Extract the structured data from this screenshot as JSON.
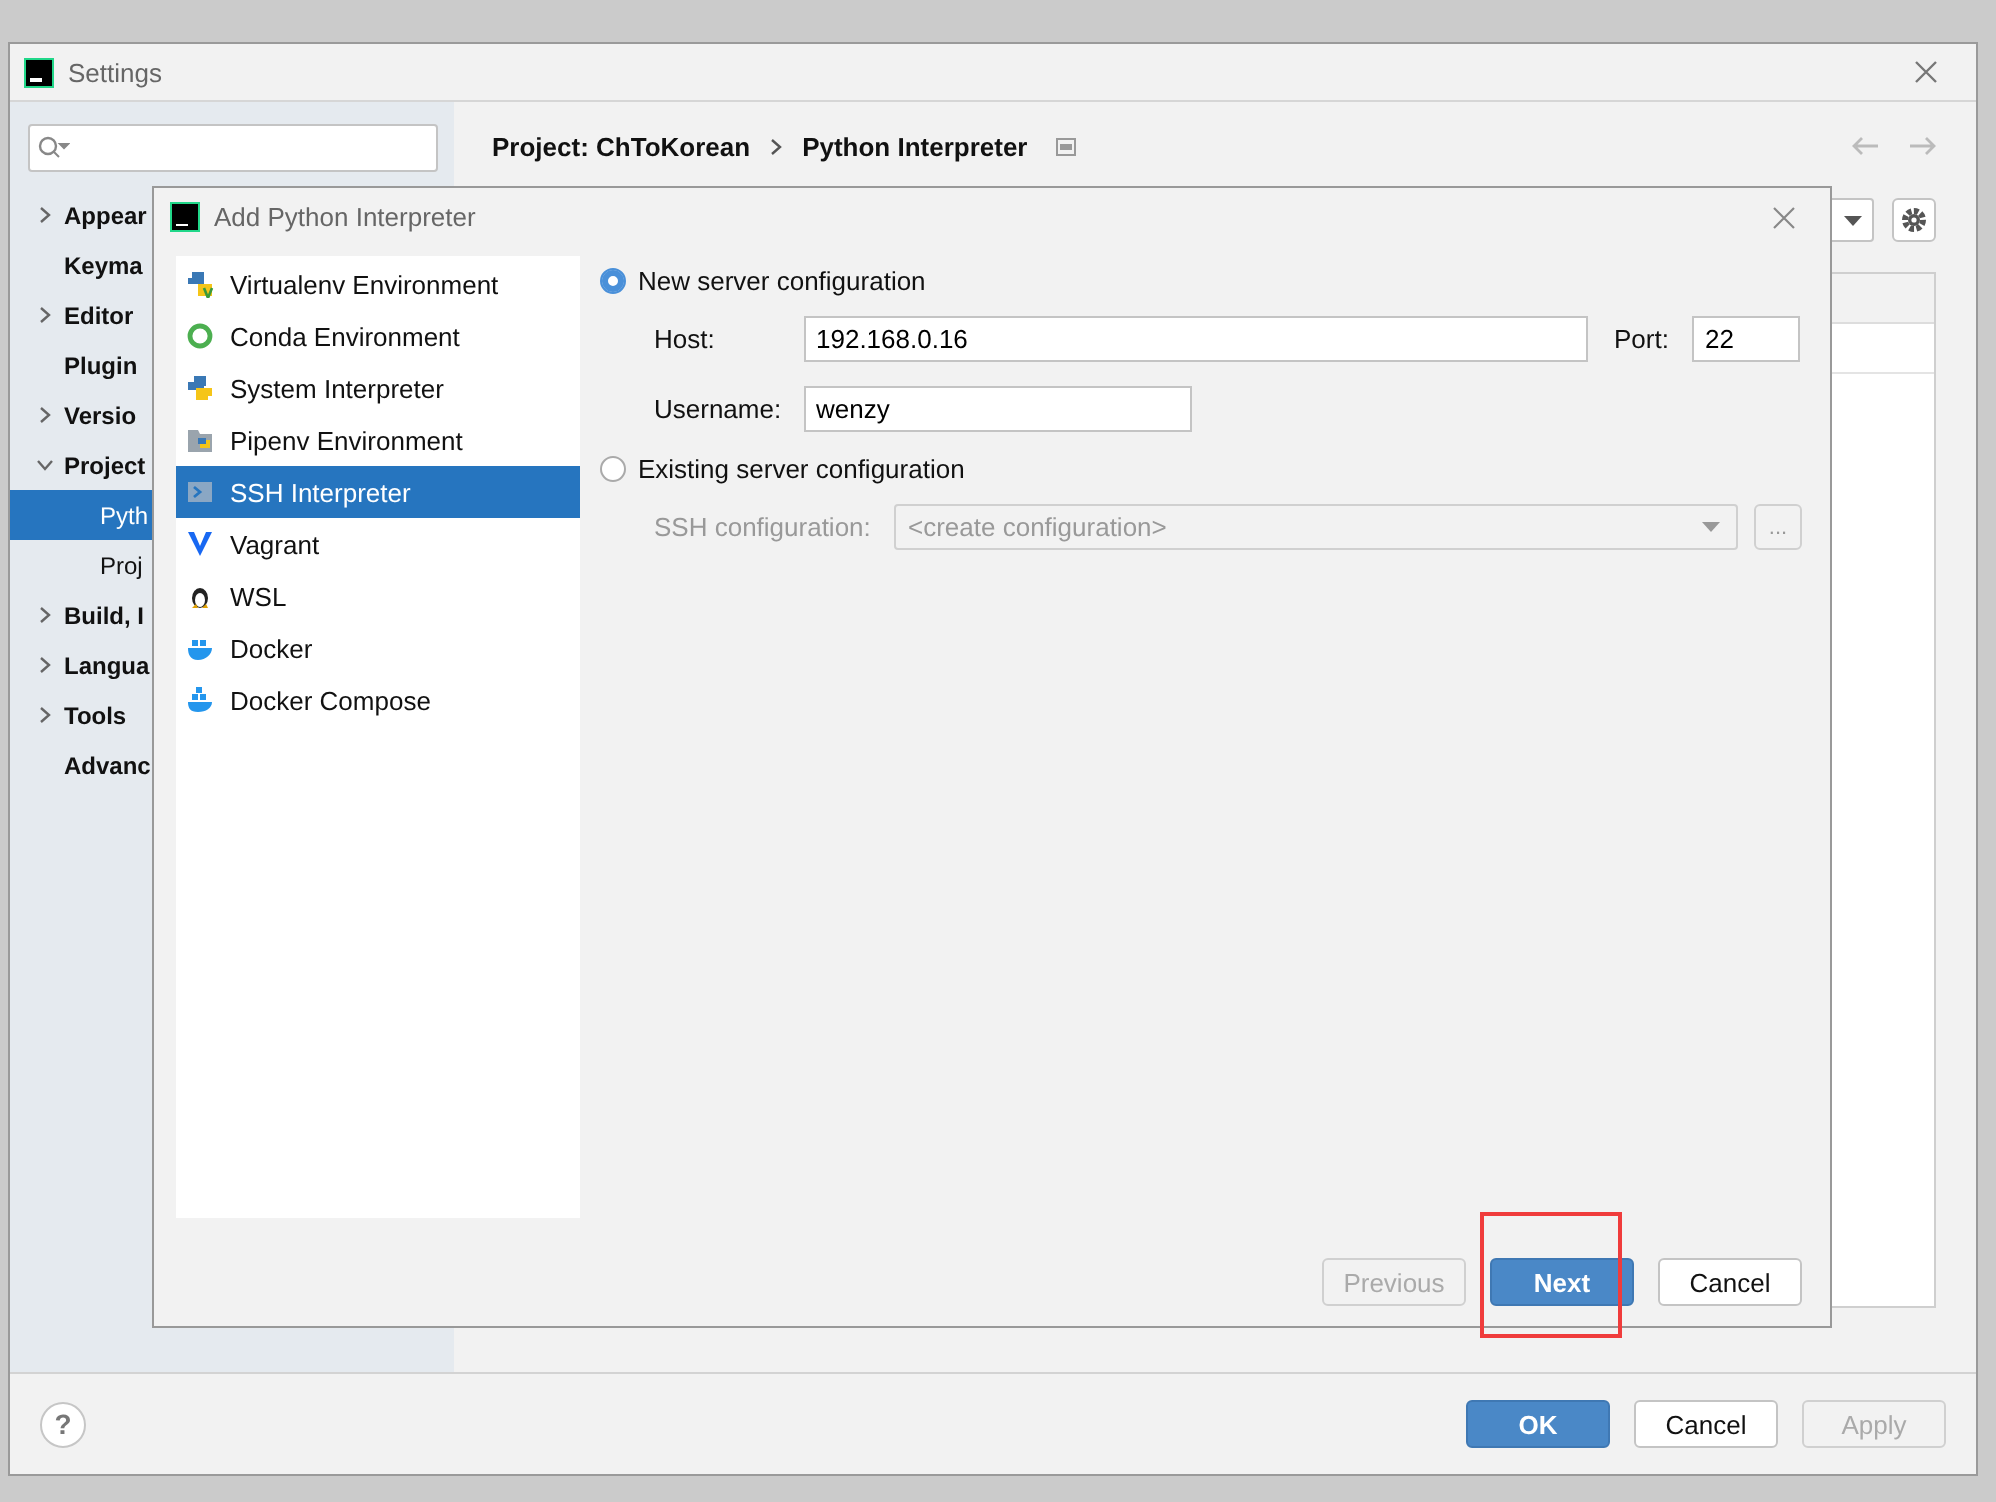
{
  "window": {
    "title": "Settings"
  },
  "sidebar": {
    "items": [
      {
        "label": "Appear",
        "kind": "group",
        "expanded": false,
        "selected": false
      },
      {
        "label": "Keyma",
        "kind": "leaf",
        "selected": false
      },
      {
        "label": "Editor",
        "kind": "group",
        "expanded": false,
        "selected": false
      },
      {
        "label": "Plugin",
        "kind": "leaf",
        "selected": false
      },
      {
        "label": "Versio",
        "kind": "group",
        "expanded": false,
        "selected": false
      },
      {
        "label": "Project",
        "kind": "group",
        "expanded": true,
        "selected": false,
        "children": [
          {
            "label": "Pyth",
            "selected": true
          },
          {
            "label": "Proj",
            "selected": false
          }
        ]
      },
      {
        "label": "Build, I",
        "kind": "group",
        "expanded": false,
        "selected": false
      },
      {
        "label": "Langua",
        "kind": "group",
        "expanded": false,
        "selected": false
      },
      {
        "label": "Tools",
        "kind": "group",
        "expanded": false,
        "selected": false
      },
      {
        "label": "Advanc",
        "kind": "leaf",
        "selected": false
      }
    ]
  },
  "breadcrumb": [
    "Project: ChToKorean",
    "Python Interpreter"
  ],
  "dialog": {
    "title": "Add Python Interpreter",
    "interpreter_types": [
      {
        "label": "Virtualenv Environment",
        "kind": "virtualenv",
        "selected": false
      },
      {
        "label": "Conda Environment",
        "kind": "conda",
        "selected": false
      },
      {
        "label": "System Interpreter",
        "kind": "python",
        "selected": false
      },
      {
        "label": "Pipenv Environment",
        "kind": "pipenv",
        "selected": false
      },
      {
        "label": "SSH Interpreter",
        "kind": "ssh",
        "selected": true
      },
      {
        "label": "Vagrant",
        "kind": "vagrant",
        "selected": false
      },
      {
        "label": "WSL",
        "kind": "wsl",
        "selected": false
      },
      {
        "label": "Docker",
        "kind": "docker",
        "selected": false
      },
      {
        "label": "Docker Compose",
        "kind": "compose",
        "selected": false
      }
    ],
    "options": [
      {
        "label": "New server configuration",
        "selected": true
      },
      {
        "label": "Existing server configuration",
        "selected": false
      }
    ],
    "host": {
      "label": "Host:",
      "value": "192.168.0.16"
    },
    "port": {
      "label": "Port:",
      "value": "22"
    },
    "username": {
      "label": "Username:",
      "value": "wenzy"
    },
    "ssh_configuration": {
      "label": "SSH configuration:",
      "value": "<create configuration>",
      "disabled": true,
      "browse": "..."
    },
    "buttons": [
      {
        "label": "Previous",
        "kind": "normal",
        "disabled": true
      },
      {
        "label": "Next",
        "kind": "default",
        "disabled": false
      },
      {
        "label": "Cancel",
        "kind": "normal",
        "disabled": false
      }
    ],
    "annotation": {
      "kind": "rectangle"
    }
  },
  "footer": {
    "help": "?",
    "buttons": [
      {
        "label": "OK",
        "kind": "default",
        "disabled": false
      },
      {
        "label": "Cancel",
        "kind": "normal",
        "disabled": false
      },
      {
        "label": "Apply",
        "kind": "normal",
        "disabled": true
      }
    ]
  }
}
